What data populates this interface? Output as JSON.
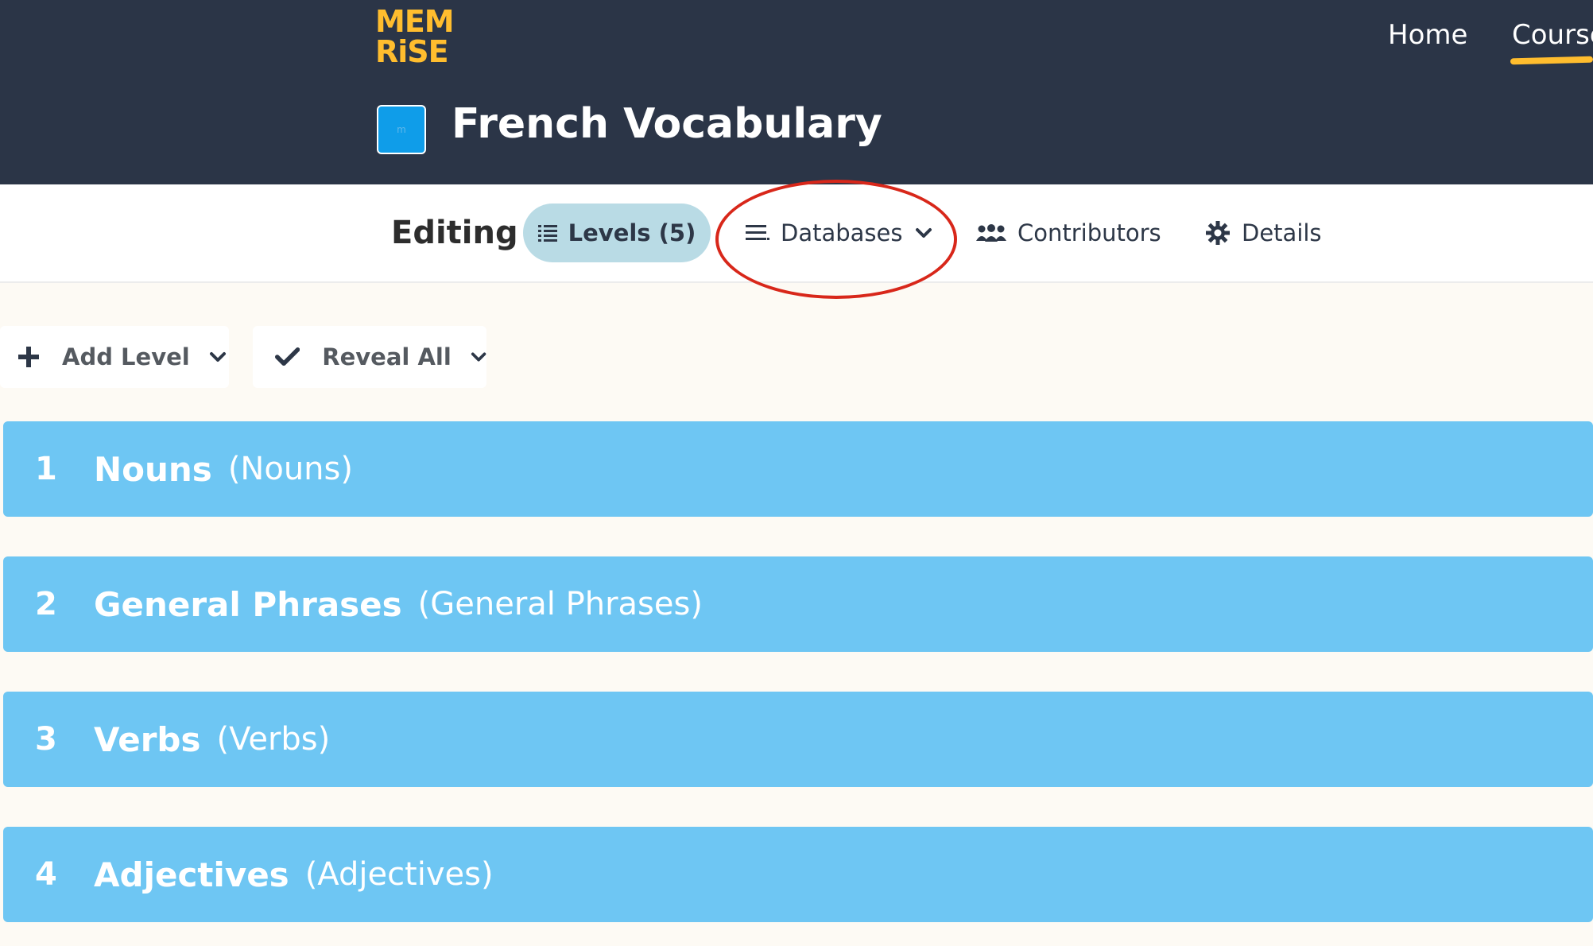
{
  "header": {
    "logo_line1": "MEM",
    "logo_line2": "RiSE",
    "nav": {
      "home": "Home",
      "courses": "Courses"
    },
    "course_title": "French Vocabulary",
    "course_icon_letter": "m"
  },
  "tabs": {
    "editing_label": "Editing",
    "levels": "Levels (5)",
    "databases": "Databases",
    "contributors": "Contributors",
    "details": "Details"
  },
  "toolbar": {
    "add_level": "Add Level",
    "reveal_all": "Reveal All"
  },
  "levels": [
    {
      "number": "1",
      "name": "Nouns",
      "subtitle": "(Nouns)"
    },
    {
      "number": "2",
      "name": "General Phrases",
      "subtitle": "(General Phrases)"
    },
    {
      "number": "3",
      "name": "Verbs",
      "subtitle": "(Verbs)"
    },
    {
      "number": "4",
      "name": "Adjectives",
      "subtitle": "(Adjectives)"
    }
  ],
  "colors": {
    "header_bg": "#2b3547",
    "brand_yellow": "#ffbd2e",
    "level_row": "#6ec6f3",
    "levels_tab_active": "#b9dbe5",
    "annotation_circle": "#d8271a",
    "page_bg": "#fdfaf4"
  },
  "icons": [
    "plus-icon",
    "check-icon",
    "chevron-down-icon",
    "list-icon",
    "menu-icon",
    "people-icon",
    "gear-icon"
  ]
}
